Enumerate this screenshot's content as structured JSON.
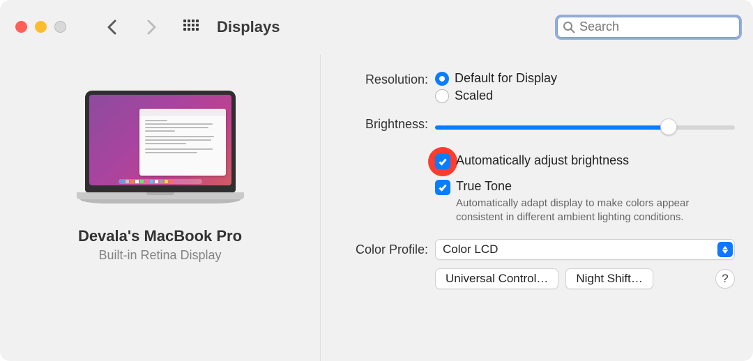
{
  "toolbar": {
    "title": "Displays",
    "search_placeholder": "Search"
  },
  "device": {
    "name": "Devala's MacBook Pro",
    "subtitle": "Built-in Retina Display"
  },
  "labels": {
    "resolution": "Resolution:",
    "brightness": "Brightness:",
    "color_profile": "Color Profile:"
  },
  "resolution": {
    "default": "Default for Display",
    "scaled": "Scaled",
    "selected": "default"
  },
  "brightness": {
    "value": 78,
    "auto": {
      "checked": true,
      "label": "Automatically adjust brightness",
      "annotation_color": "#ff3c2f"
    },
    "truetone": {
      "checked": true,
      "label": "True Tone",
      "description": "Automatically adapt display to make colors appear consistent in different ambient lighting conditions."
    }
  },
  "color_profile": {
    "selected": "Color LCD"
  },
  "buttons": {
    "universal": "Universal Control…",
    "night_shift": "Night Shift…",
    "help": "?"
  },
  "colors": {
    "accent": "#0a7cff"
  }
}
